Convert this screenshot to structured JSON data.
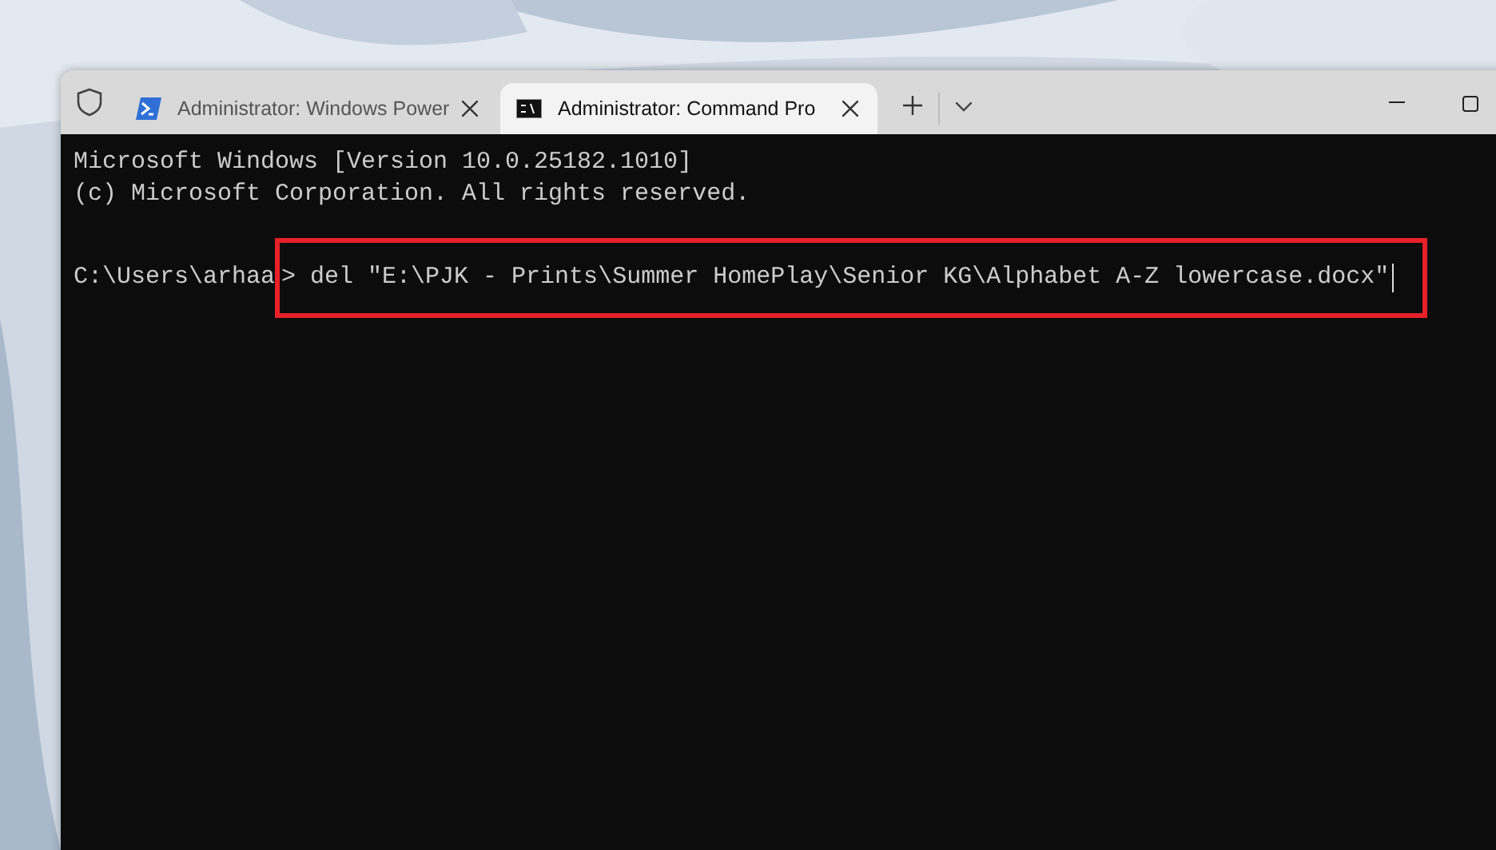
{
  "tabs": [
    {
      "title": "Administrator: Windows Power",
      "kind": "powershell",
      "selected": false
    },
    {
      "title": "Administrator: Command Pro",
      "kind": "cmd",
      "selected": true
    }
  ],
  "terminal": {
    "lines": [
      "Microsoft Windows [Version 10.0.25182.1010]",
      "(c) Microsoft Corporation. All rights reserved."
    ],
    "prompt": "C:\\Users\\arhaa",
    "command": "> del \"E:\\PJK - Prints\\Summer HomePlay\\Senior KG\\Alphabet A-Z lowercase.docx\"",
    "highlighted": true
  }
}
